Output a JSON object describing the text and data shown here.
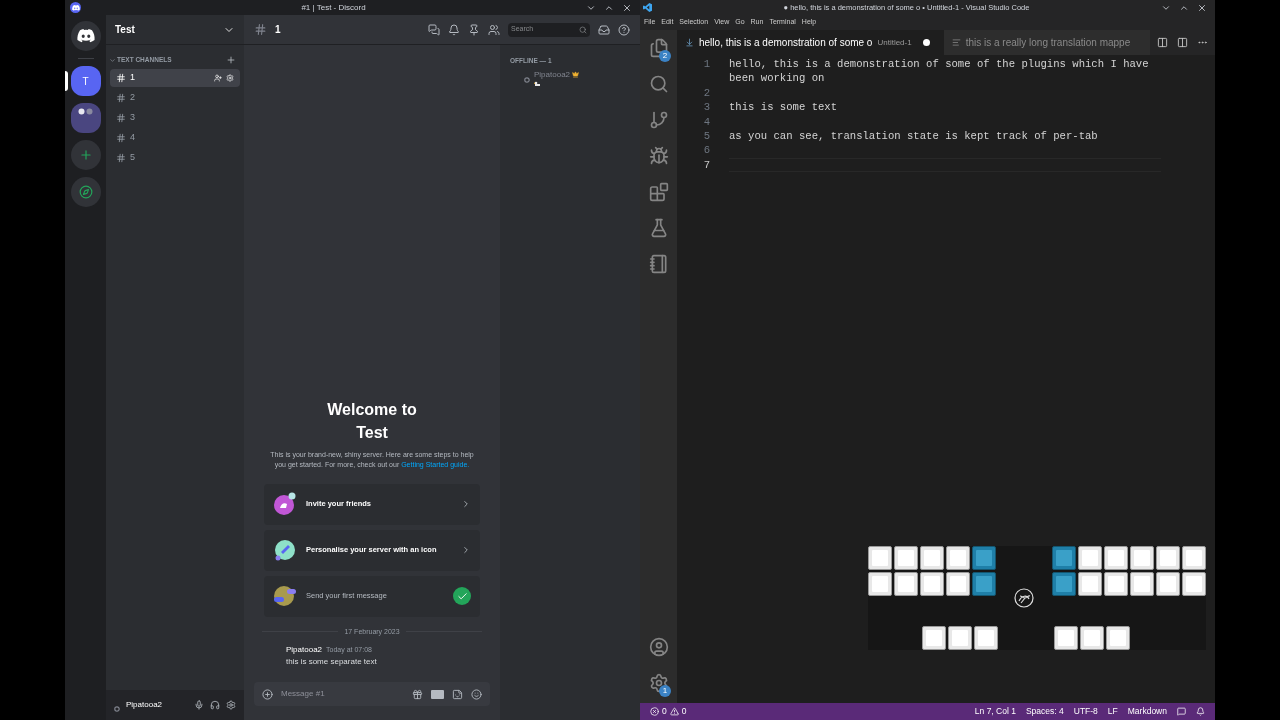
{
  "discord": {
    "window_title": "#1 | Test - Discord",
    "servers": [
      {
        "kind": "home",
        "selected": false
      },
      {
        "kind": "letter",
        "label": "T",
        "selected": true
      },
      {
        "kind": "folder",
        "selected": false
      },
      {
        "kind": "add",
        "selected": false
      },
      {
        "kind": "explore",
        "selected": false
      }
    ],
    "server_name": "Test",
    "category": "TEXT CHANNELS",
    "channels": [
      {
        "name": "1",
        "selected": true
      },
      {
        "name": "2",
        "selected": false
      },
      {
        "name": "3",
        "selected": false
      },
      {
        "name": "4",
        "selected": false
      },
      {
        "name": "5",
        "selected": false
      }
    ],
    "header": {
      "channel": "1",
      "search_placeholder": "Search"
    },
    "welcome": {
      "title": "Welcome to Test",
      "body": "This is your brand-new, shiny server. Here are some steps to help you get started. For more, check out our",
      "link": "Getting Started guide."
    },
    "steps": [
      {
        "kind": "invite",
        "label": "Invite your friends",
        "done": false
      },
      {
        "kind": "personalise",
        "label": "Personalise your server with an icon",
        "done": false
      },
      {
        "kind": "message",
        "label": "Send your first message",
        "done": true
      }
    ],
    "date_divider": "17 February 2023",
    "message": {
      "author": "Pipatooa2",
      "time": "Today at 07:08",
      "text": "this is some separate text"
    },
    "composer_placeholder": "Message #1",
    "members": {
      "group": "OFFLINE — 1",
      "items": [
        {
          "name": "Pipatooa2",
          "owner": true
        }
      ]
    },
    "user": {
      "name": "Pipatooa2"
    }
  },
  "vscode": {
    "window_title": "● hello, this is a demonstration of some o • Untitled-1 - Visual Studio Code",
    "menu": [
      "File",
      "Edit",
      "Selection",
      "View",
      "Go",
      "Run",
      "Terminal",
      "Help"
    ],
    "activity": [
      {
        "kind": "explorer",
        "badge": "2"
      },
      {
        "kind": "search"
      },
      {
        "kind": "source-control"
      },
      {
        "kind": "debug"
      },
      {
        "kind": "extensions"
      },
      {
        "kind": "testing"
      },
      {
        "kind": "notebook"
      }
    ],
    "activity_bottom": [
      {
        "kind": "account"
      },
      {
        "kind": "settings",
        "badge": "1"
      }
    ],
    "tabs": [
      {
        "title": "hello, this is a demonstration of some o",
        "description": "Untitled-1",
        "dirty": true,
        "selected": true
      },
      {
        "title": "this is a really long translation mappe",
        "selected": false
      }
    ],
    "lines": [
      {
        "number": "1",
        "text": "hello, this is a demonstration of some of the plugins which I have been working on",
        "current": false
      },
      {
        "number": "2",
        "current": false
      },
      {
        "number": "3",
        "text": "this is some text",
        "current": false
      },
      {
        "number": "4",
        "current": false
      },
      {
        "number": "5",
        "text": "as you can see, translation state is kept track of per-tab",
        "current": false
      },
      {
        "number": "6",
        "current": false
      },
      {
        "number": "7",
        "current": true
      }
    ],
    "keyboard": {
      "left": [
        [
          {
            "pressed": false
          },
          {
            "pressed": false
          },
          {
            "pressed": false
          },
          {
            "pressed": false
          },
          {
            "pressed": true
          }
        ],
        [
          {
            "pressed": false
          },
          {
            "pressed": false
          },
          {
            "pressed": false
          },
          {
            "pressed": false
          },
          {
            "pressed": true
          }
        ]
      ],
      "right": [
        [
          {
            "pressed": true
          },
          {
            "pressed": false
          },
          {
            "pressed": false
          },
          {
            "pressed": false
          },
          {
            "pressed": false
          },
          {
            "pressed": false
          }
        ],
        [
          {
            "pressed": true
          },
          {
            "pressed": false
          },
          {
            "pressed": false
          },
          {
            "pressed": false
          },
          {
            "pressed": false
          },
          {
            "pressed": false
          }
        ]
      ],
      "thumbs_left": [
        {
          "pressed": false
        },
        {
          "pressed": false
        },
        {
          "pressed": false
        }
      ],
      "thumbs_right": [
        {
          "pressed": false
        },
        {
          "pressed": false
        },
        {
          "pressed": false
        }
      ]
    },
    "status": {
      "errors": "0",
      "warnings": "0",
      "items": [
        "Ln 7, Col 1",
        "Spaces: 4",
        "UTF-8",
        "LF",
        "Markdown"
      ]
    }
  }
}
